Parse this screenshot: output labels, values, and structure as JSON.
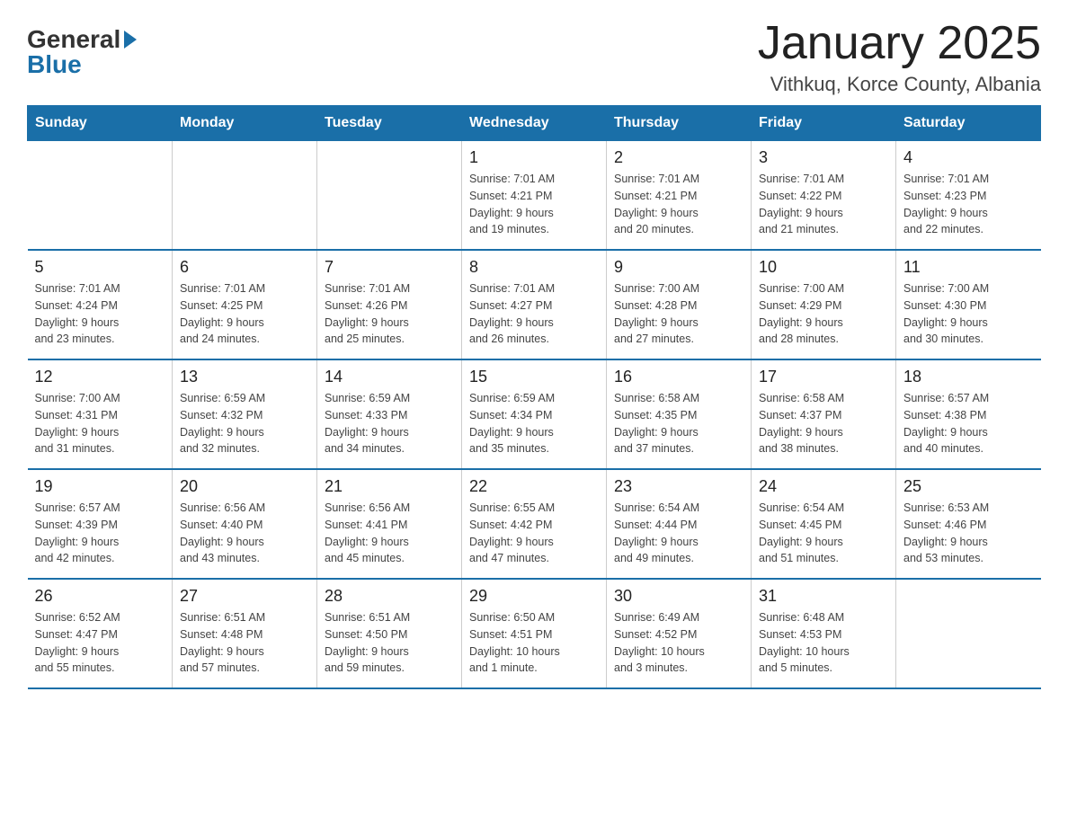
{
  "logo": {
    "general": "General",
    "blue": "Blue"
  },
  "title": "January 2025",
  "subtitle": "Vithkuq, Korce County, Albania",
  "days_of_week": [
    "Sunday",
    "Monday",
    "Tuesday",
    "Wednesday",
    "Thursday",
    "Friday",
    "Saturday"
  ],
  "weeks": [
    [
      {
        "day": "",
        "info": ""
      },
      {
        "day": "",
        "info": ""
      },
      {
        "day": "",
        "info": ""
      },
      {
        "day": "1",
        "info": "Sunrise: 7:01 AM\nSunset: 4:21 PM\nDaylight: 9 hours\nand 19 minutes."
      },
      {
        "day": "2",
        "info": "Sunrise: 7:01 AM\nSunset: 4:21 PM\nDaylight: 9 hours\nand 20 minutes."
      },
      {
        "day": "3",
        "info": "Sunrise: 7:01 AM\nSunset: 4:22 PM\nDaylight: 9 hours\nand 21 minutes."
      },
      {
        "day": "4",
        "info": "Sunrise: 7:01 AM\nSunset: 4:23 PM\nDaylight: 9 hours\nand 22 minutes."
      }
    ],
    [
      {
        "day": "5",
        "info": "Sunrise: 7:01 AM\nSunset: 4:24 PM\nDaylight: 9 hours\nand 23 minutes."
      },
      {
        "day": "6",
        "info": "Sunrise: 7:01 AM\nSunset: 4:25 PM\nDaylight: 9 hours\nand 24 minutes."
      },
      {
        "day": "7",
        "info": "Sunrise: 7:01 AM\nSunset: 4:26 PM\nDaylight: 9 hours\nand 25 minutes."
      },
      {
        "day": "8",
        "info": "Sunrise: 7:01 AM\nSunset: 4:27 PM\nDaylight: 9 hours\nand 26 minutes."
      },
      {
        "day": "9",
        "info": "Sunrise: 7:00 AM\nSunset: 4:28 PM\nDaylight: 9 hours\nand 27 minutes."
      },
      {
        "day": "10",
        "info": "Sunrise: 7:00 AM\nSunset: 4:29 PM\nDaylight: 9 hours\nand 28 minutes."
      },
      {
        "day": "11",
        "info": "Sunrise: 7:00 AM\nSunset: 4:30 PM\nDaylight: 9 hours\nand 30 minutes."
      }
    ],
    [
      {
        "day": "12",
        "info": "Sunrise: 7:00 AM\nSunset: 4:31 PM\nDaylight: 9 hours\nand 31 minutes."
      },
      {
        "day": "13",
        "info": "Sunrise: 6:59 AM\nSunset: 4:32 PM\nDaylight: 9 hours\nand 32 minutes."
      },
      {
        "day": "14",
        "info": "Sunrise: 6:59 AM\nSunset: 4:33 PM\nDaylight: 9 hours\nand 34 minutes."
      },
      {
        "day": "15",
        "info": "Sunrise: 6:59 AM\nSunset: 4:34 PM\nDaylight: 9 hours\nand 35 minutes."
      },
      {
        "day": "16",
        "info": "Sunrise: 6:58 AM\nSunset: 4:35 PM\nDaylight: 9 hours\nand 37 minutes."
      },
      {
        "day": "17",
        "info": "Sunrise: 6:58 AM\nSunset: 4:37 PM\nDaylight: 9 hours\nand 38 minutes."
      },
      {
        "day": "18",
        "info": "Sunrise: 6:57 AM\nSunset: 4:38 PM\nDaylight: 9 hours\nand 40 minutes."
      }
    ],
    [
      {
        "day": "19",
        "info": "Sunrise: 6:57 AM\nSunset: 4:39 PM\nDaylight: 9 hours\nand 42 minutes."
      },
      {
        "day": "20",
        "info": "Sunrise: 6:56 AM\nSunset: 4:40 PM\nDaylight: 9 hours\nand 43 minutes."
      },
      {
        "day": "21",
        "info": "Sunrise: 6:56 AM\nSunset: 4:41 PM\nDaylight: 9 hours\nand 45 minutes."
      },
      {
        "day": "22",
        "info": "Sunrise: 6:55 AM\nSunset: 4:42 PM\nDaylight: 9 hours\nand 47 minutes."
      },
      {
        "day": "23",
        "info": "Sunrise: 6:54 AM\nSunset: 4:44 PM\nDaylight: 9 hours\nand 49 minutes."
      },
      {
        "day": "24",
        "info": "Sunrise: 6:54 AM\nSunset: 4:45 PM\nDaylight: 9 hours\nand 51 minutes."
      },
      {
        "day": "25",
        "info": "Sunrise: 6:53 AM\nSunset: 4:46 PM\nDaylight: 9 hours\nand 53 minutes."
      }
    ],
    [
      {
        "day": "26",
        "info": "Sunrise: 6:52 AM\nSunset: 4:47 PM\nDaylight: 9 hours\nand 55 minutes."
      },
      {
        "day": "27",
        "info": "Sunrise: 6:51 AM\nSunset: 4:48 PM\nDaylight: 9 hours\nand 57 minutes."
      },
      {
        "day": "28",
        "info": "Sunrise: 6:51 AM\nSunset: 4:50 PM\nDaylight: 9 hours\nand 59 minutes."
      },
      {
        "day": "29",
        "info": "Sunrise: 6:50 AM\nSunset: 4:51 PM\nDaylight: 10 hours\nand 1 minute."
      },
      {
        "day": "30",
        "info": "Sunrise: 6:49 AM\nSunset: 4:52 PM\nDaylight: 10 hours\nand 3 minutes."
      },
      {
        "day": "31",
        "info": "Sunrise: 6:48 AM\nSunset: 4:53 PM\nDaylight: 10 hours\nand 5 minutes."
      },
      {
        "day": "",
        "info": ""
      }
    ]
  ]
}
